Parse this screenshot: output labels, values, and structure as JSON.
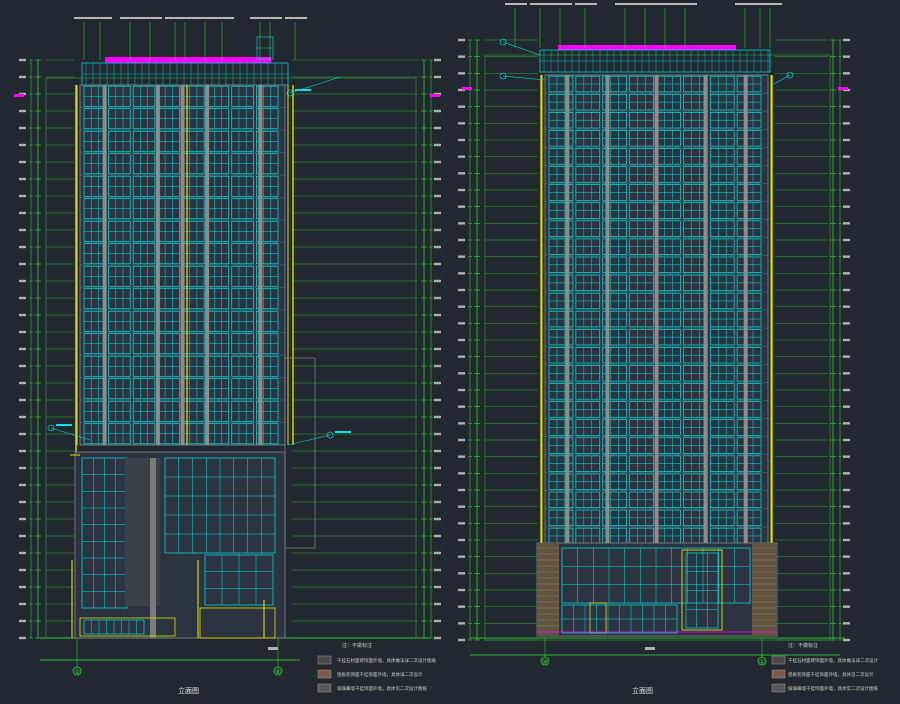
{
  "drawing": {
    "background": "#212830",
    "colors": {
      "dim": "#33e033",
      "glass": "#00e5e5",
      "frame": "#8a8a8a",
      "accent": "#e0e000",
      "roof": "#ff00ff",
      "label": "#e8e8e8",
      "note": "#d0d0d0",
      "brick": "#c89060"
    },
    "left_view": {
      "title": "立面图",
      "axis_from": "①",
      "axis_to": "⑥",
      "floors_label": "注：不做标注",
      "notes": [
        "干挂石材面砖饰面外墙，具体做法详二次设计图纸",
        "铝板装饰面干挂饰面外墙，具体详二次设计",
        "玻璃幕墙干挂饰面外墙，具体见二次设计图纸"
      ]
    },
    "right_view": {
      "title": "立面图",
      "axis_from": "⑩",
      "axis_to": "①",
      "floors_label": "注：不做标注",
      "notes": [
        "干挂石材面砖饰面外墙，具体做法详二次设计",
        "铝板装饰面干挂饰面外墙，具体见二次设计",
        "玻璃幕墙干挂饰面外墙，具体见二次设计图纸"
      ]
    }
  }
}
